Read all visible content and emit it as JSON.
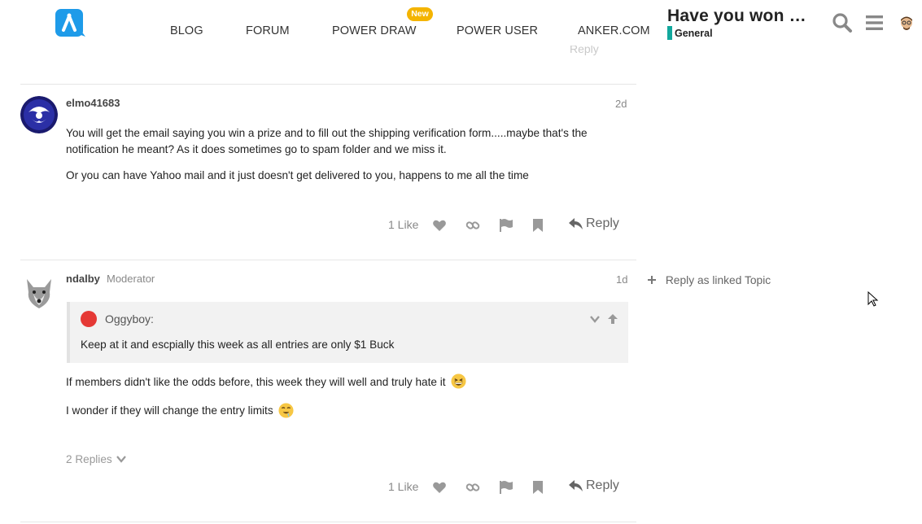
{
  "header": {
    "nav": [
      "BLOG",
      "FORUM",
      "POWER DRAW",
      "POWER USER",
      "ANKER.COM"
    ],
    "new_badge": "New",
    "topic_title": "Have you won …",
    "category": "General",
    "category_color": "#12a89d",
    "icons": [
      "search-icon",
      "hamburger-menu-icon",
      "user-avatar"
    ]
  },
  "ghost_row": {
    "reply_label": "Reply"
  },
  "posts": [
    {
      "username": "elmo41683",
      "date": "2d",
      "paragraphs": [
        "You will get the email saying you win a prize and to fill out the shipping verification form.....maybe that's the",
        "notification he meant? As it does sometimes go to spam folder and we miss it.",
        "Or you can have Yahoo mail and it just doesn't get delivered to you, happens to me all the time"
      ],
      "likes": "1 Like",
      "reply_label": "Reply"
    },
    {
      "username": "ndalby",
      "role": "Moderator",
      "date": "1d",
      "quote": {
        "author": "Oggyboy:",
        "text": "Keep at it and escpially this week as all entries are only $1 Buck"
      },
      "paragraphs": [
        "If members didn't like the odds before, this week they will well and truly hate it",
        "I wonder if they will change the entry limits"
      ],
      "replies": "2 Replies",
      "likes": "1 Like",
      "reply_label": "Reply"
    }
  ],
  "sidebar": {
    "linked_topic": "Reply as linked Topic"
  },
  "colors": {
    "accent_badge": "#f4b400",
    "brand_blue": "#1e9be9"
  }
}
